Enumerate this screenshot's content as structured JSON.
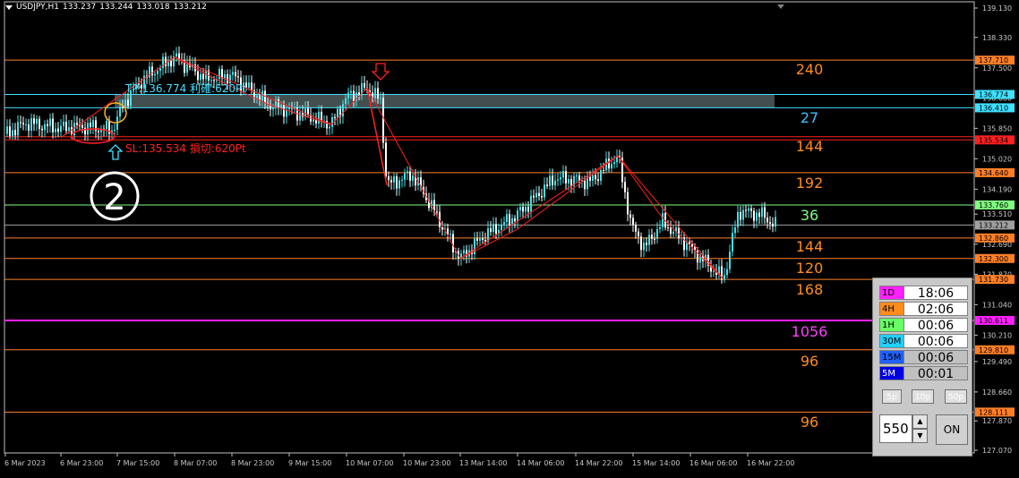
{
  "header": {
    "symbol": "USDJPY,H1",
    "open": "133.237",
    "high": "133.244",
    "low": "133.018",
    "close": "133.212"
  },
  "chart_data": {
    "type": "candlestick",
    "symbol": "USDJPY",
    "timeframe": "H1",
    "ylim": [
      126.6,
      139.3
    ],
    "y_ticks": [
      "139.130",
      "138.330",
      "137.500",
      "136.680",
      "135.850",
      "135.020",
      "134.190",
      "133.510",
      "132.690",
      "131.870",
      "131.040",
      "130.210",
      "129.490",
      "128.660",
      "127.870",
      "127.070"
    ],
    "x_ticks": [
      "6 Mar 2023",
      "6 Mar 23:00",
      "7 Mar 15:00",
      "8 Mar 07:00",
      "8 Mar 23:00",
      "9 Mar 15:00",
      "10 Mar 07:00",
      "10 Mar 23:00",
      "13 Mar 14:00",
      "14 Mar 06:00",
      "14 Mar 22:00",
      "15 Mar 14:00",
      "16 Mar 06:00",
      "16 Mar 22:00"
    ],
    "horizontal_levels": [
      {
        "price": 137.71,
        "label": "137.710",
        "color": "#ff7f27",
        "pips_label": "240"
      },
      {
        "price": 136.774,
        "label": "136.774",
        "color": "#40e0ff",
        "pips_label": ""
      },
      {
        "price": 136.41,
        "label": "136.410",
        "color": "#40e0ff",
        "pips_label": "27"
      },
      {
        "price": 135.534,
        "label": "135.534",
        "color": "#ff2020",
        "pips_label": "144"
      },
      {
        "price": 134.64,
        "label": "134.640",
        "color": "#ff7f27",
        "pips_label": "192"
      },
      {
        "price": 133.76,
        "label": "133.760",
        "color": "#7fff7f",
        "pips_label": "36"
      },
      {
        "price": 133.212,
        "label": "133.212",
        "color": "#a0a0a0",
        "pips_label": ""
      },
      {
        "price": 132.86,
        "label": "132.860",
        "color": "#ff7f27",
        "pips_label": "144"
      },
      {
        "price": 132.3,
        "label": "132.300",
        "color": "#ff7f27",
        "pips_label": "120"
      },
      {
        "price": 131.73,
        "label": "131.730",
        "color": "#ff7f27",
        "pips_label": "168"
      },
      {
        "price": 130.611,
        "label": "130.611",
        "color": "#ff20ff",
        "pips_label": "1056"
      },
      {
        "price": 129.81,
        "label": "129.810",
        "color": "#ff7f27",
        "pips_label": "96"
      },
      {
        "price": 128.111,
        "label": "128.111",
        "color": "#ff7f27",
        "pips_label": "96"
      }
    ],
    "zigzag_points": [
      [
        135.6,
        "6 Mar 23:00"
      ],
      [
        137.79,
        "8 Mar 07:00"
      ],
      [
        135.95,
        "9 Mar 15:00"
      ],
      [
        136.95,
        "10 Mar 07:00"
      ],
      [
        132.3,
        "13 Mar 14:00"
      ],
      [
        135.1,
        "14 Mar 22:00"
      ],
      [
        131.73,
        "16 Mar 06:00"
      ]
    ],
    "annotations": {
      "tp_text": "TP:136.774 利確:620Pt",
      "sl_text": "SL:135.534 損切:620Pt",
      "marker": "②"
    }
  },
  "timer_panel": {
    "rows": [
      {
        "label": "1D",
        "value": "18:06",
        "label_color": "#ff20ff",
        "value_bg": "#ffffff"
      },
      {
        "label": "4H",
        "value": "02:06",
        "label_color": "#ff8c1a",
        "value_bg": "#ffffff"
      },
      {
        "label": "1H",
        "value": "00:06",
        "label_color": "#66ff66",
        "value_bg": "#ffffff"
      },
      {
        "label": "30M",
        "value": "00:06",
        "label_color": "#20d0ff",
        "value_bg": "#ffffff"
      },
      {
        "label": "15M",
        "value": "00:06",
        "label_color": "#2060ff",
        "value_bg": "#c0c0c0"
      },
      {
        "label": "5M",
        "value": "00:01",
        "label_color": "#0000e0",
        "value_bg": "#c0c0c0"
      }
    ],
    "pip_buttons": [
      "5p",
      "10p",
      "50p"
    ],
    "spin_value": "550",
    "on_label": "ON"
  }
}
